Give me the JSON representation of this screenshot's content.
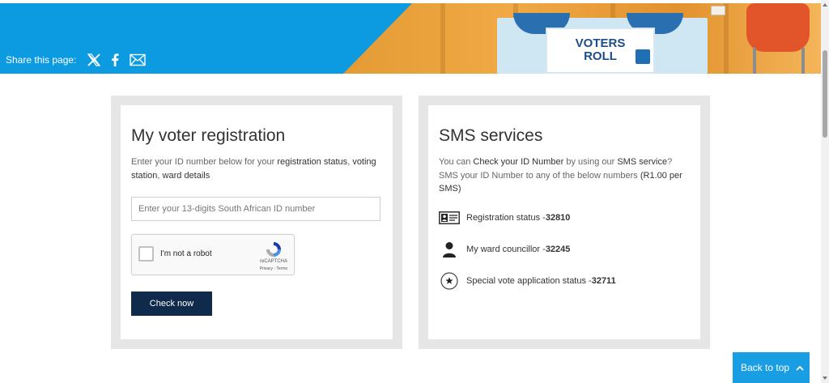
{
  "banner": {
    "share_label": "Share this page:",
    "share_icons": [
      "x-icon",
      "facebook-icon",
      "email-icon"
    ],
    "photo_sign_line1": "VOTERS",
    "photo_sign_line2": "ROLL"
  },
  "registration": {
    "title": "My voter registration",
    "desc_prefix": "Enter your ID number below for your ",
    "desc_bold1": "registration status",
    "desc_mid": ", ",
    "desc_bold2": "voting station",
    "desc_comma": ", ",
    "desc_bold3": "ward details",
    "input_placeholder": "Enter your 13-digits South African ID number",
    "input_value": "",
    "captcha_label": "I'm not a robot",
    "captcha_brand": "reCAPTCHA",
    "captcha_terms": "Privacy - Terms",
    "button_label": "Check now"
  },
  "sms": {
    "title": "SMS services",
    "desc_prefix": "You can ",
    "desc_bold1": "Check your ID Number",
    "desc_mid1": " by using our ",
    "desc_bold2": "SMS service",
    "desc_mid2": "? SMS your ID Number to any of the below numbers ",
    "desc_bold3": "(R1.00 per SMS)",
    "items": [
      {
        "icon": "id-card-icon",
        "label": "Registration status - ",
        "number": "32810"
      },
      {
        "icon": "person-icon",
        "label": "My ward councillor - ",
        "number": "32245"
      },
      {
        "icon": "star-circle-icon",
        "label": "Special vote application status - ",
        "number": "32711"
      }
    ]
  },
  "back_to_top": {
    "label": "Back to top",
    "icon": "chevron-up-icon"
  },
  "colors": {
    "banner_blue": "#0c9ae0",
    "button_navy": "#0f2a4a",
    "back_top_blue": "#1a9ee3",
    "card_border": "#e6e6e6"
  }
}
